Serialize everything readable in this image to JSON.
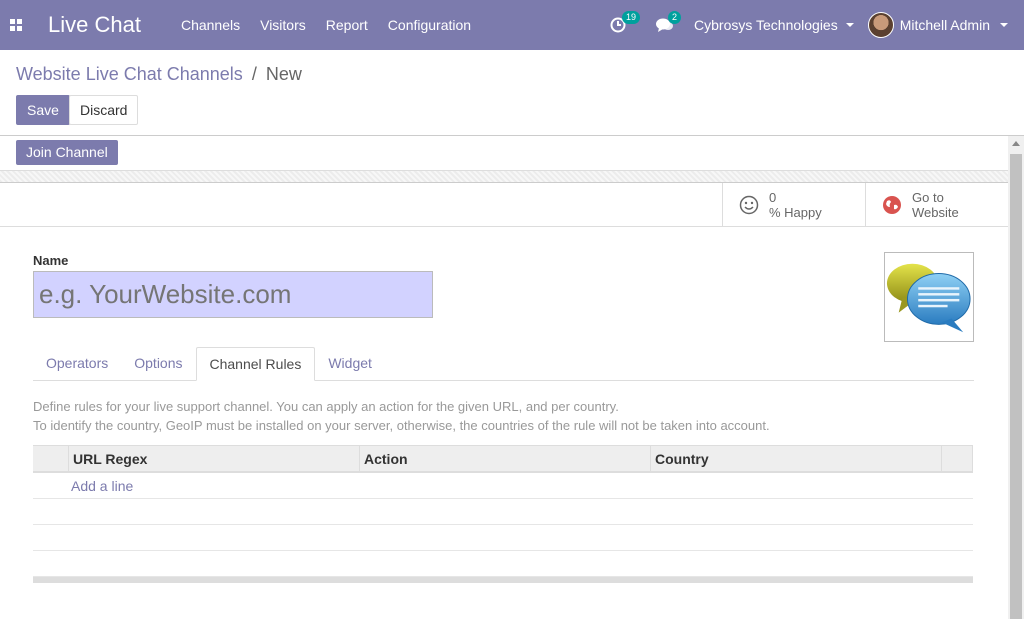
{
  "navbar": {
    "app_name": "Live Chat",
    "menu": [
      {
        "label": "Channels"
      },
      {
        "label": "Visitors"
      },
      {
        "label": "Report"
      },
      {
        "label": "Configuration"
      }
    ],
    "activity_count": "19",
    "messages_count": "2",
    "company": "Cybrosys Technologies",
    "user": "Mitchell Admin"
  },
  "breadcrumb": {
    "parent": "Website Live Chat Channels",
    "separator": "/",
    "current": "New"
  },
  "buttons": {
    "save": "Save",
    "discard": "Discard",
    "join": "Join Channel"
  },
  "stat_buttons": {
    "happy_value": "0",
    "happy_label": "% Happy",
    "website_line1": "Go to",
    "website_line2": "Website"
  },
  "form": {
    "name_label": "Name",
    "name_placeholder": "e.g. YourWebsite.com"
  },
  "tabs": [
    {
      "label": "Operators"
    },
    {
      "label": "Options"
    },
    {
      "label": "Channel Rules"
    },
    {
      "label": "Widget"
    }
  ],
  "active_tab": "Channel Rules",
  "help": {
    "line1": "Define rules for your live support channel. You can apply an action for the given URL, and per country.",
    "line2": "To identify the country, GeoIP must be installed on your server, otherwise, the countries of the rule will not be taken into account."
  },
  "table": {
    "columns": [
      "URL Regex",
      "Action",
      "Country"
    ],
    "add_line": "Add a line"
  },
  "colors": {
    "brand": "#7c7bad",
    "badge": "#00a09d",
    "input_bg": "#d2d2ff"
  }
}
